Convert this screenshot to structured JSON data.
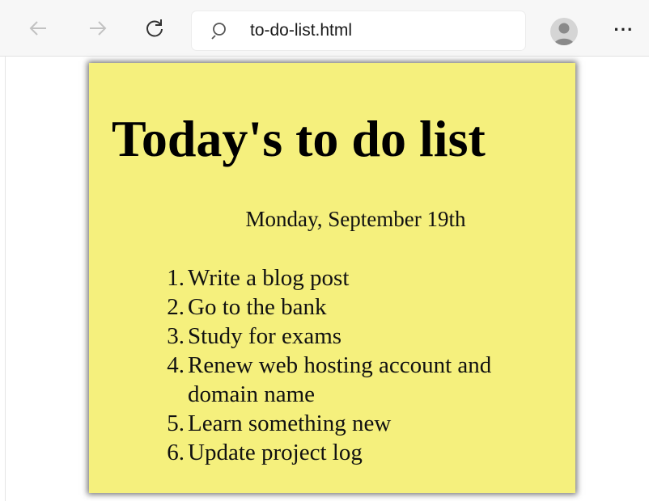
{
  "browser": {
    "url": "to-do-list.html",
    "menu_label": "···"
  },
  "note": {
    "title": "Today's to do list",
    "date": "Monday, September 19th",
    "items": [
      {
        "num": "1.",
        "text": "Write a blog post"
      },
      {
        "num": "2.",
        "text": "Go to the bank"
      },
      {
        "num": "3.",
        "text": "Study for exams"
      },
      {
        "num": "4.",
        "text": "Renew web hosting account and domain name"
      },
      {
        "num": "5.",
        "text": "Learn something new"
      },
      {
        "num": "6.",
        "text": "Update project log"
      }
    ],
    "background": "#f5f07d"
  }
}
